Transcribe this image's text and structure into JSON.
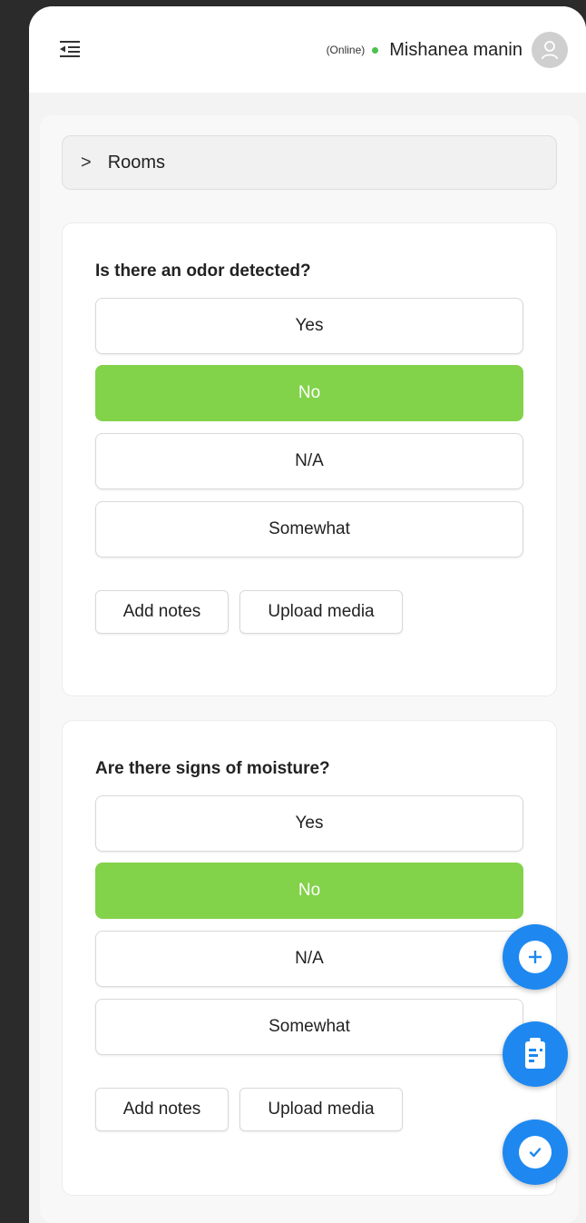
{
  "header": {
    "online_status": "(Online)",
    "user_name": "Mishanea manin"
  },
  "rooms": {
    "label": "Rooms"
  },
  "questions": [
    {
      "text": "Is there an odor detected?",
      "options": [
        "Yes",
        "No",
        "N/A",
        "Somewhat"
      ],
      "selected": "No",
      "add_notes": "Add notes",
      "upload_media": "Upload media"
    },
    {
      "text": "Are there signs of moisture?",
      "options": [
        "Yes",
        "No",
        "N/A",
        "Somewhat"
      ],
      "selected": "No",
      "add_notes": "Add notes",
      "upload_media": "Upload media"
    }
  ],
  "colors": {
    "selected_option": "#82d24a",
    "fab": "#1e88f0",
    "online_dot": "#4cc24c"
  },
  "fabs": [
    "plus-icon",
    "clipboard-icon",
    "check-icon"
  ]
}
